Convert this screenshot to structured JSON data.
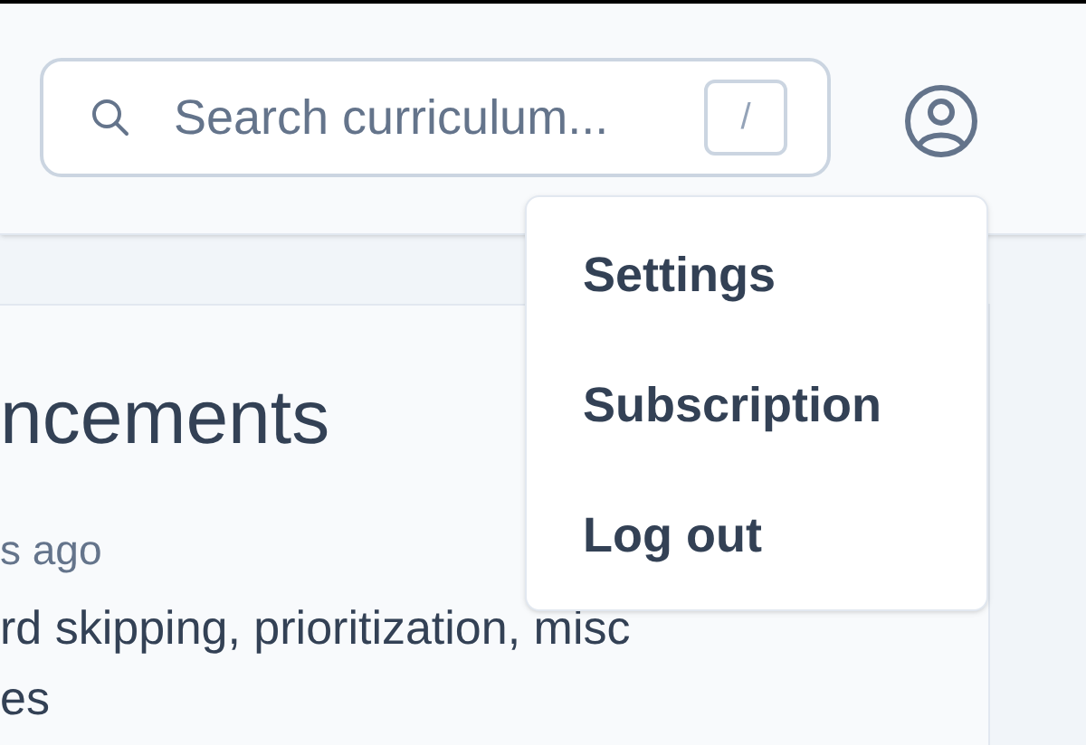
{
  "search": {
    "placeholder": "Search curriculum...",
    "shortcut": "/"
  },
  "card": {
    "title": "ncements",
    "time": "s ago",
    "lines": [
      "rd skipping, prioritization, misc",
      "es"
    ]
  },
  "menu": {
    "items": [
      {
        "label": "Settings"
      },
      {
        "label": "Subscription"
      },
      {
        "label": "Log out"
      }
    ]
  }
}
